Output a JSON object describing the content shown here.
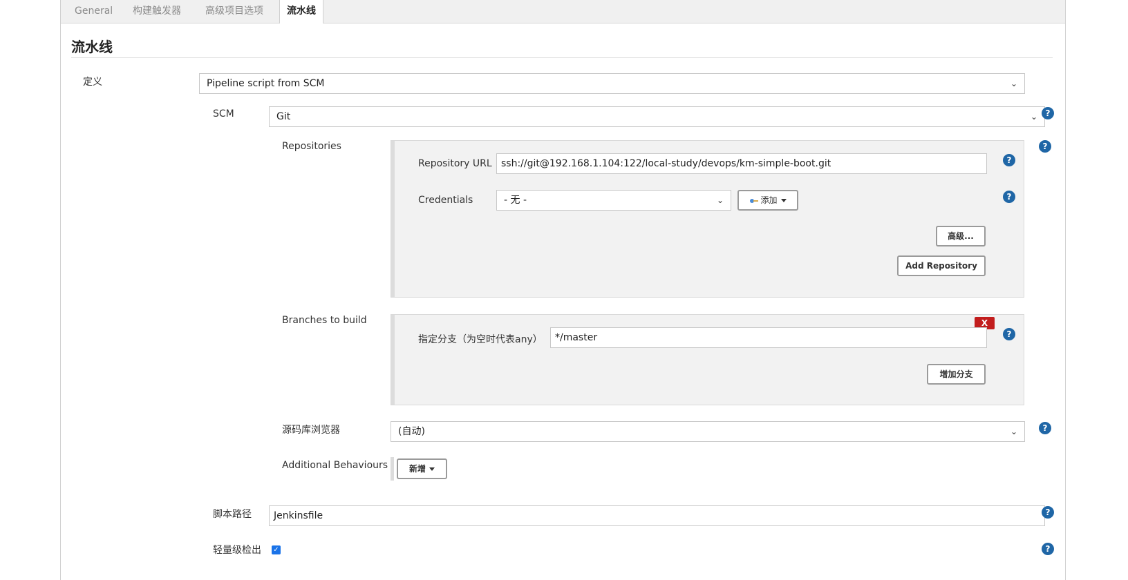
{
  "tabs": [
    {
      "label": "General",
      "active": false
    },
    {
      "label": "构建触发器",
      "active": false
    },
    {
      "label": "高级项目选项",
      "active": false
    },
    {
      "label": "流水线",
      "active": true
    }
  ],
  "section": {
    "title": "流水线"
  },
  "definition": {
    "label": "定义",
    "value": "Pipeline script from SCM"
  },
  "scm": {
    "label": "SCM",
    "value": "Git"
  },
  "repositories": {
    "label": "Repositories",
    "url_label": "Repository URL",
    "url_value": "ssh://git@192.168.1.104:122/local-study/devops/km-simple-boot.git",
    "credentials_label": "Credentials",
    "credentials_value": "- 无 -",
    "add_label": "添加",
    "advanced_label": "高级...",
    "add_repo_label": "Add Repository"
  },
  "branches": {
    "label": "Branches to build",
    "branch_label": "指定分支（为空时代表any）",
    "branch_value": "*/master",
    "remove_label": "X",
    "add_branch_label": "增加分支"
  },
  "browser": {
    "label": "源码库浏览器",
    "value": "(自动)"
  },
  "behaviours": {
    "label": "Additional Behaviours",
    "add_label": "新增"
  },
  "script_path": {
    "label": "脚本路径",
    "value": "Jenkinsfile"
  },
  "lightweight": {
    "label": "轻量级检出",
    "checked": true
  },
  "help": {
    "symbol": "?"
  },
  "colors": {
    "help": "#1f66a6",
    "remove": "#c21d1d",
    "checkbox": "#1a73e8"
  }
}
